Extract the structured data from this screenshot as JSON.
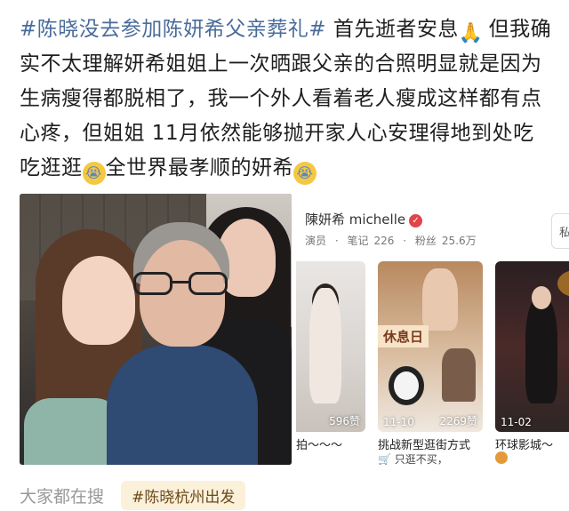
{
  "post": {
    "hashtag": "#陈晓没去参加陈妍希父亲葬礼#",
    "text_1": " 首先逝者安息",
    "text_2": " 但我确实不太理解妍希姐姐上一次晒跟父亲的合照明显就是因为生病瘦得都脱相了，我一个外人看着老人瘦成这样都有点心疼，但姐姐 11月依然能够抛开家人心安理得地到处吃吃逛逛",
    "text_3": "全世界最孝顺的妍希",
    "emoji_pray": "🙏",
    "emoji_cry": "😭"
  },
  "profile": {
    "name": "陳妍希 michelle",
    "verified_icon": "✓",
    "role": "演员",
    "notes_label": "笔记",
    "notes_count": "226",
    "fans_label": "粉丝",
    "fans_count": "25.6万",
    "dm_label": "私"
  },
  "cards": [
    {
      "title": "拍～～～",
      "date": "",
      "likes": "596赞"
    },
    {
      "title": "挑战新型逛街方式",
      "subtitle": "只逛不买，",
      "date": "11-10",
      "likes": "2269赞",
      "sign": "休息日"
    },
    {
      "title": "环球影城～",
      "date": "11-02",
      "likes": ""
    }
  ],
  "search": {
    "label": "大家都在搜",
    "tag": "#陈晓杭州出发"
  }
}
